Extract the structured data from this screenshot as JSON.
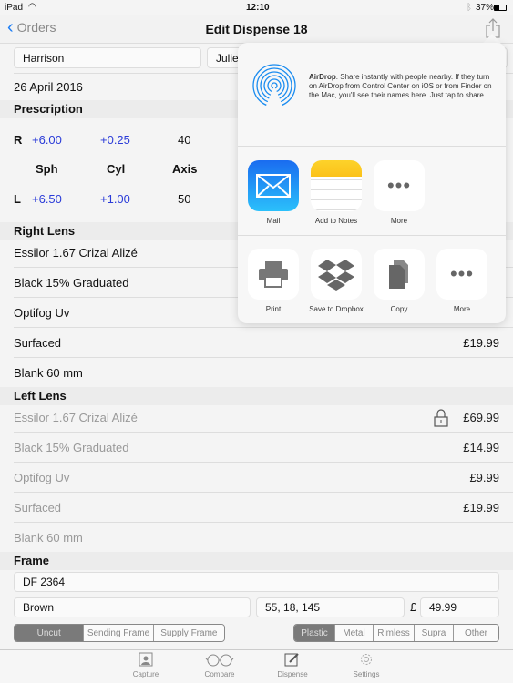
{
  "status": {
    "device": "iPad",
    "time": "12:10",
    "battery": "37%"
  },
  "nav": {
    "back": "Orders",
    "title": "Edit Dispense 18"
  },
  "customer": {
    "surname": "Harrison",
    "first_name": "Julie",
    "date": "26 April 2016"
  },
  "prescription": {
    "title": "Prescription",
    "headers": [
      "Sph",
      "Cyl",
      "Axis"
    ],
    "right": {
      "label": "R",
      "sph": "+6.00",
      "cyl": "+0.25",
      "axis": "40"
    },
    "left": {
      "label": "L",
      "sph": "+6.50",
      "cyl": "+1.00",
      "axis": "50"
    }
  },
  "right_lens": {
    "title": "Right Lens",
    "items": [
      {
        "name": "Essilor 1.67 Crizal Alizé",
        "price": ""
      },
      {
        "name": "Black 15% Graduated",
        "price": ""
      },
      {
        "name": "Optifog Uv",
        "price": ""
      },
      {
        "name": "Surfaced",
        "price": "£19.99"
      },
      {
        "name": "Blank 60 mm",
        "price": ""
      }
    ]
  },
  "left_lens": {
    "title": "Left Lens",
    "items": [
      {
        "name": "Essilor 1.67 Crizal Alizé",
        "price": "£69.99",
        "icon": "lock-icon"
      },
      {
        "name": "Black 15% Graduated",
        "price": "£14.99"
      },
      {
        "name": "Optifog Uv",
        "price": "£9.99"
      },
      {
        "name": "Surfaced",
        "price": "£19.99"
      },
      {
        "name": "Blank 60 mm",
        "price": ""
      }
    ]
  },
  "frame": {
    "title": "Frame",
    "model": "DF 2364",
    "colour": "Brown",
    "size": "55, 18, 145",
    "currency": "£",
    "price": "49.99",
    "supply": [
      "Uncut",
      "Sending Frame",
      "Supply Frame"
    ],
    "supply_selected": "Uncut",
    "material": [
      "Plastic",
      "Metal",
      "Rimless",
      "Supra",
      "Other"
    ],
    "material_selected": "Plastic"
  },
  "share": {
    "airdrop_title": "AirDrop",
    "airdrop_text": ". Share instantly with people nearby. If they turn on AirDrop from Control Center on iOS or from Finder on the Mac, you'll see their names here. Just tap to share.",
    "apps": [
      "Mail",
      "Add to Notes",
      "More"
    ],
    "actions": [
      "Print",
      "Save to Dropbox",
      "Copy",
      "More"
    ]
  },
  "tabs": [
    "Capture",
    "Compare",
    "Dispense",
    "Settings"
  ],
  "colors": {
    "accent": "#1a7cf5",
    "value_blue": "#2a3bd8"
  }
}
